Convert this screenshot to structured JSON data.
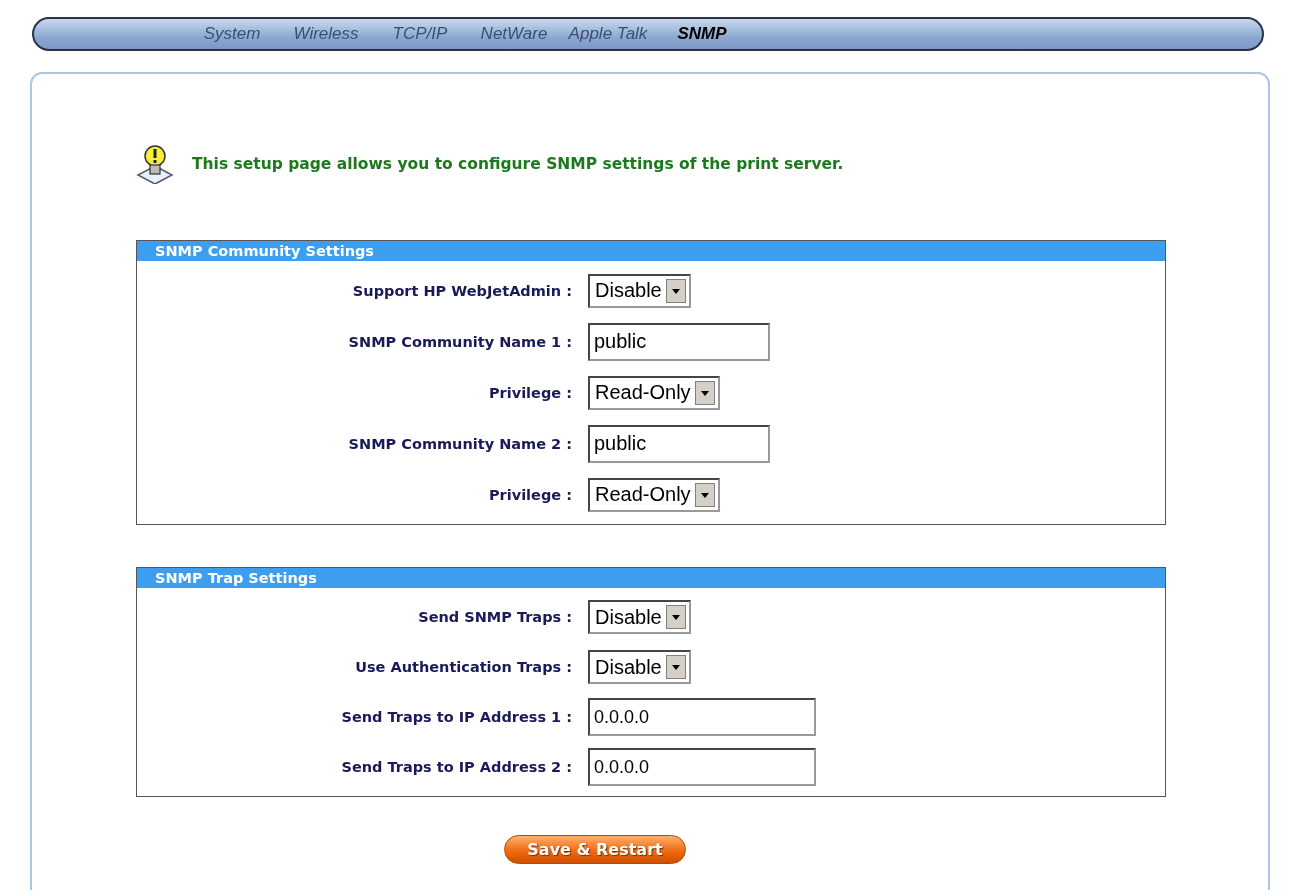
{
  "tabs": [
    {
      "label": "System",
      "selected": false
    },
    {
      "label": "Wireless",
      "selected": false
    },
    {
      "label": "TCP/IP",
      "selected": false
    },
    {
      "label": "NetWare",
      "selected": false
    },
    {
      "label": "Apple Talk",
      "selected": false
    },
    {
      "label": "SNMP",
      "selected": true
    }
  ],
  "intro": "This setup page allows you to configure SNMP settings of the print server.",
  "sections": [
    {
      "title": "SNMP Community Settings",
      "fields": [
        {
          "label": "Support HP WebJetAdmin :",
          "kind": "select",
          "value": "Disable"
        },
        {
          "label": "SNMP Community Name 1 :",
          "kind": "text",
          "value": "public"
        },
        {
          "label": "Privilege :",
          "kind": "select",
          "value": "Read-Only"
        },
        {
          "label": "SNMP Community Name 2 :",
          "kind": "text",
          "value": "public"
        },
        {
          "label": "Privilege :",
          "kind": "select",
          "value": "Read-Only"
        }
      ]
    },
    {
      "title": "SNMP Trap Settings",
      "fields": [
        {
          "label": "Send SNMP Traps :",
          "kind": "select",
          "value": "Disable"
        },
        {
          "label": "Use Authentication Traps :",
          "kind": "select",
          "value": "Disable"
        },
        {
          "label": "Send Traps to IP Address 1 :",
          "kind": "ip",
          "value": "0.0.0.0"
        },
        {
          "label": "Send Traps to IP Address 2 :",
          "kind": "ip",
          "value": "0.0.0.0"
        }
      ]
    }
  ],
  "save_button": "Save & Restart"
}
